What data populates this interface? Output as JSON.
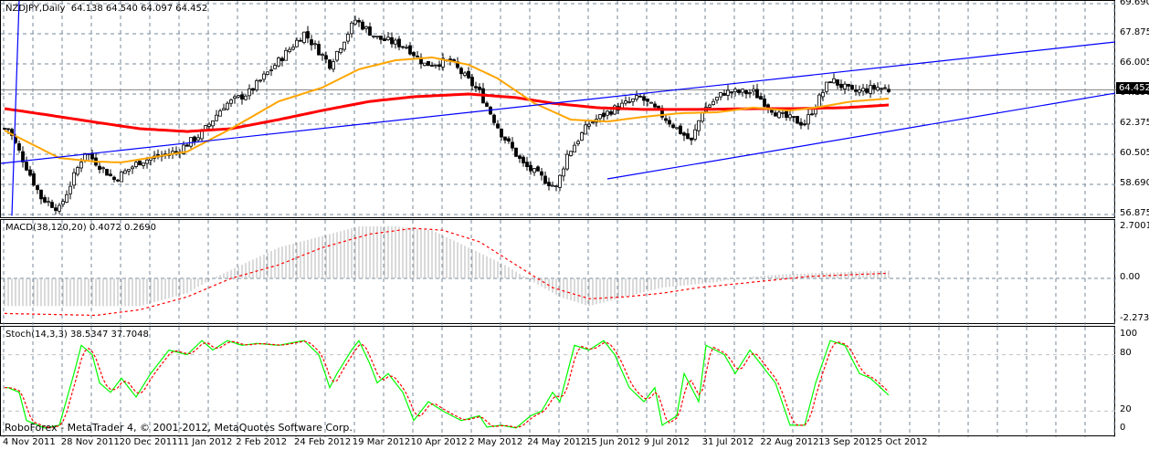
{
  "header": {
    "symbol_info": "NZDJPY,Daily  64.138 64.540 64.097 64.452"
  },
  "current_price": "64.452",
  "macd_header": "MACD(38,120,20) 0.4072 0.2690",
  "stoch_header": "Stoch(14,3,3) 38.5347 37.7048",
  "copyright": "RoboForex - MetaTrader 4, © 2001-2012, MetaQuotes Software Corp.",
  "colors": {
    "grid": "#778899",
    "ma_fast": "#FFA500",
    "ma_slow": "#FF0000",
    "trend": "#0000FF",
    "macd_hist": "#C0C0C0",
    "macd_signal": "#FF0000",
    "stoch_k": "#00FF00",
    "stoch_d": "#FF0000"
  },
  "price_axis": [
    "69.690",
    "67.875",
    "66.005",
    "64.190",
    "62.375",
    "60.505",
    "58.690",
    "56.875"
  ],
  "macd_axis": [
    "2.7001",
    "0.00",
    "-2.2731"
  ],
  "stoch_axis": [
    "100",
    "80",
    "20",
    "0"
  ],
  "time_axis": [
    "4 Nov 2011",
    "28 Nov 2011",
    "20 Dec 2011",
    "11 Jan 2012",
    "2 Feb 2012",
    "24 Feb 2012",
    "19 Mar 2012",
    "10 Apr 2012",
    "2 May 2012",
    "24 May 2012",
    "15 Jun 2012",
    "9 Jul 2012",
    "31 Jul 2012",
    "22 Aug 2012",
    "13 Sep 2012",
    "5 Oct 2012"
  ],
  "chart_data": [
    {
      "type": "candlestick",
      "title": "NZDJPY,Daily",
      "ylim": [
        56.875,
        69.69
      ],
      "bars": 243,
      "close_anchors": [
        [
          1,
          62.1
        ],
        [
          10,
          57.9
        ],
        [
          15,
          57.2
        ],
        [
          22,
          60.7
        ],
        [
          30,
          59.0
        ],
        [
          37,
          60.1
        ],
        [
          47,
          60.7
        ],
        [
          54,
          61.8
        ],
        [
          60,
          63.5
        ],
        [
          67,
          64.3
        ],
        [
          75,
          66.2
        ],
        [
          82,
          67.9
        ],
        [
          89,
          66.0
        ],
        [
          96,
          68.7
        ],
        [
          102,
          67.6
        ],
        [
          110,
          67.1
        ],
        [
          115,
          66.0
        ],
        [
          122,
          66.2
        ],
        [
          130,
          64.3
        ],
        [
          136,
          61.8
        ],
        [
          142,
          59.9
        ],
        [
          151,
          58.5
        ],
        [
          154,
          60.5
        ],
        [
          160,
          62.4
        ],
        [
          166,
          63.2
        ],
        [
          174,
          64.0
        ],
        [
          180,
          62.9
        ],
        [
          188,
          61.3
        ],
        [
          191,
          63.2
        ],
        [
          197,
          64.3
        ],
        [
          205,
          64.3
        ],
        [
          212,
          62.9
        ],
        [
          219,
          62.4
        ],
        [
          226,
          65.1
        ],
        [
          232,
          64.3
        ],
        [
          239,
          64.6
        ],
        [
          242,
          64.452
        ]
      ],
      "ma_fast": [
        [
          0,
          61.98
        ],
        [
          15,
          60.31
        ],
        [
          25,
          60.09
        ],
        [
          32,
          60.04
        ],
        [
          50,
          60.7
        ],
        [
          62,
          62.09
        ],
        [
          75,
          63.75
        ],
        [
          87,
          64.59
        ],
        [
          97,
          65.7
        ],
        [
          107,
          66.25
        ],
        [
          117,
          66.42
        ],
        [
          127,
          65.98
        ],
        [
          135,
          65.14
        ],
        [
          145,
          63.64
        ],
        [
          155,
          62.64
        ],
        [
          165,
          62.53
        ],
        [
          175,
          62.81
        ],
        [
          185,
          63.03
        ],
        [
          195,
          63.09
        ],
        [
          205,
          63.37
        ],
        [
          215,
          63.2
        ],
        [
          222,
          63.37
        ],
        [
          232,
          63.75
        ],
        [
          242,
          63.92
        ]
      ],
      "ma_slow": [
        [
          0,
          63.31
        ],
        [
          12,
          62.92
        ],
        [
          25,
          62.48
        ],
        [
          37,
          62.09
        ],
        [
          50,
          61.92
        ],
        [
          62,
          62.09
        ],
        [
          75,
          62.64
        ],
        [
          87,
          63.2
        ],
        [
          100,
          63.75
        ],
        [
          112,
          64.03
        ],
        [
          127,
          64.2
        ],
        [
          140,
          63.98
        ],
        [
          150,
          63.64
        ],
        [
          162,
          63.37
        ],
        [
          175,
          63.26
        ],
        [
          190,
          63.26
        ],
        [
          205,
          63.31
        ],
        [
          217,
          63.31
        ],
        [
          230,
          63.37
        ],
        [
          242,
          63.53
        ]
      ],
      "trendlines": [
        {
          "from": [
            -1,
            59.98
          ],
          "to": [
            304,
            67.36
          ]
        },
        {
          "from": [
            165,
            59.04
          ],
          "to": [
            304,
            64.25
          ]
        },
        {
          "from": [
            2,
            56.8
          ],
          "to": [
            4,
            69.9
          ]
        }
      ],
      "hline": 64.452
    },
    {
      "type": "bar",
      "title": "MACD(38,120,20)",
      "ylim": [
        -2.2731,
        2.7001
      ],
      "hist_anchors": [
        [
          0,
          -1.5
        ],
        [
          37,
          -1.5
        ],
        [
          50,
          -0.8
        ],
        [
          57,
          0
        ],
        [
          75,
          1.6
        ],
        [
          87,
          2.2
        ],
        [
          97,
          2.7
        ],
        [
          107,
          2.7
        ],
        [
          117,
          2.5
        ],
        [
          127,
          1.6
        ],
        [
          137,
          0.7
        ],
        [
          143,
          0
        ],
        [
          152,
          -1.0
        ],
        [
          160,
          -1.5
        ],
        [
          170,
          -1.0
        ],
        [
          180,
          -0.5
        ],
        [
          195,
          -0.2
        ],
        [
          200,
          0
        ],
        [
          212,
          0.2
        ],
        [
          242,
          0.41
        ]
      ],
      "signal_anchors": [
        [
          0,
          -1.9
        ],
        [
          25,
          -2.0
        ],
        [
          37,
          -1.7
        ],
        [
          50,
          -1.0
        ],
        [
          62,
          0
        ],
        [
          75,
          0.7
        ],
        [
          87,
          1.6
        ],
        [
          100,
          2.3
        ],
        [
          112,
          2.6
        ],
        [
          120,
          2.5
        ],
        [
          130,
          1.9
        ],
        [
          140,
          0.7
        ],
        [
          150,
          -0.5
        ],
        [
          160,
          -1.1
        ],
        [
          170,
          -1.0
        ],
        [
          180,
          -0.8
        ],
        [
          190,
          -0.5
        ],
        [
          205,
          -0.2
        ],
        [
          220,
          0.1
        ],
        [
          242,
          0.27
        ]
      ]
    },
    {
      "type": "line",
      "title": "Stoch(14,3,3)",
      "ylim": [
        0,
        100
      ],
      "levels": [
        20,
        80
      ],
      "k_anchors": [
        [
          1,
          45
        ],
        [
          4,
          40
        ],
        [
          6,
          10
        ],
        [
          11,
          2
        ],
        [
          15,
          5
        ],
        [
          19,
          60
        ],
        [
          21,
          90
        ],
        [
          24,
          80
        ],
        [
          26,
          50
        ],
        [
          29,
          40
        ],
        [
          32,
          55
        ],
        [
          36,
          35
        ],
        [
          40,
          60
        ],
        [
          45,
          85
        ],
        [
          50,
          80
        ],
        [
          54,
          95
        ],
        [
          57,
          85
        ],
        [
          61,
          95
        ],
        [
          65,
          90
        ],
        [
          69,
          92
        ],
        [
          75,
          90
        ],
        [
          82,
          95
        ],
        [
          86,
          80
        ],
        [
          89,
          45
        ],
        [
          91,
          60
        ],
        [
          95,
          85
        ],
        [
          97,
          95
        ],
        [
          100,
          70
        ],
        [
          102,
          50
        ],
        [
          105,
          60
        ],
        [
          109,
          40
        ],
        [
          112,
          10
        ],
        [
          116,
          30
        ],
        [
          120,
          20
        ],
        [
          125,
          10
        ],
        [
          130,
          15
        ],
        [
          132,
          3
        ],
        [
          136,
          5
        ],
        [
          140,
          2
        ],
        [
          144,
          15
        ],
        [
          147,
          20
        ],
        [
          150,
          40
        ],
        [
          152,
          30
        ],
        [
          156,
          90
        ],
        [
          160,
          85
        ],
        [
          164,
          95
        ],
        [
          167,
          80
        ],
        [
          171,
          45
        ],
        [
          175,
          30
        ],
        [
          178,
          45
        ],
        [
          180,
          5
        ],
        [
          184,
          15
        ],
        [
          186,
          60
        ],
        [
          190,
          30
        ],
        [
          192,
          90
        ],
        [
          197,
          80
        ],
        [
          200,
          60
        ],
        [
          204,
          85
        ],
        [
          207,
          70
        ],
        [
          211,
          50
        ],
        [
          215,
          5
        ],
        [
          219,
          5
        ],
        [
          222,
          50
        ],
        [
          226,
          95
        ],
        [
          230,
          90
        ],
        [
          234,
          60
        ],
        [
          237,
          55
        ],
        [
          242,
          37
        ]
      ]
    }
  ]
}
